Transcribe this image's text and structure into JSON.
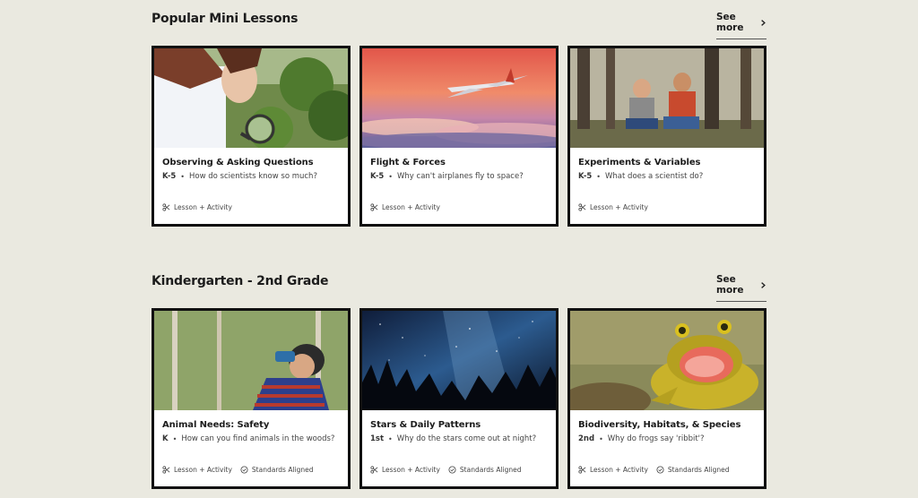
{
  "sections": [
    {
      "title": "Popular Mini Lessons",
      "see_more": "See more",
      "cards": [
        {
          "title": "Observing & Asking Questions",
          "grade": "K-5",
          "question": "How do scientists know so much?",
          "meta": [
            "Lesson + Activity"
          ],
          "image": "magnifying-glass-photo"
        },
        {
          "title": "Flight & Forces",
          "grade": "K-5",
          "question": "Why can't airplanes fly to space?",
          "meta": [
            "Lesson + Activity"
          ],
          "image": "airplane-photo"
        },
        {
          "title": "Experiments & Variables",
          "grade": "K-5",
          "question": "What does a scientist do?",
          "meta": [
            "Lesson + Activity"
          ],
          "image": "kids-forest-photo"
        }
      ]
    },
    {
      "title": "Kindergarten - 2nd Grade",
      "see_more": "See more",
      "cards": [
        {
          "title": "Animal Needs: Safety",
          "grade": "K",
          "question": "How can you find animals in the woods?",
          "meta": [
            "Lesson + Activity",
            "Standards Aligned"
          ],
          "image": "binoculars-photo"
        },
        {
          "title": "Stars & Daily Patterns",
          "grade": "1st",
          "question": "Why do the stars come out at night?",
          "meta": [
            "Lesson + Activity",
            "Standards Aligned"
          ],
          "image": "night-sky-photo"
        },
        {
          "title": "Biodiversity, Habitats, & Species",
          "grade": "2nd",
          "question": "Why do frogs say 'ribbit'?",
          "meta": [
            "Lesson + Activity",
            "Standards Aligned"
          ],
          "image": "frog-photo"
        }
      ]
    }
  ],
  "icons": {
    "lesson": "scissors-icon",
    "standards": "check-circle-icon",
    "see_more": "chevron-right-icon"
  }
}
